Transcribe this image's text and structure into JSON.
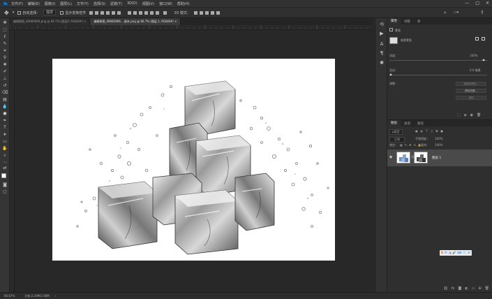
{
  "menubar": {
    "logo": "Ps",
    "items": [
      "文件(F)",
      "编辑(E)",
      "图像(I)",
      "图层(L)",
      "文字(Y)",
      "选择(S)",
      "滤镜(T)",
      "3D(D)",
      "视图(V)",
      "窗口(W)",
      "帮助(H)"
    ],
    "window_controls": [
      "—",
      "□",
      "✕"
    ]
  },
  "options_bar": {
    "auto_select_label": "自动选择：",
    "auto_select_value": "图层",
    "show_transform_label": "显示变换控件",
    "mode_3d_label": "3D 模式："
  },
  "doc_tabs": [
    {
      "label": "编辑原图_49083906.png @ 66.7% (图层0, RGB/8#) ×",
      "active": false
    },
    {
      "label": "编辑原图_49083906... 副本.png @ 66.7% (图层 1, RGB/8#) ×",
      "active": true
    }
  ],
  "status": {
    "zoom": "66.67%",
    "doc_info": "文档:2.20M/2.48M"
  },
  "properties_panel": {
    "tabs": [
      "属性",
      "调整",
      "库"
    ],
    "section_label": "蒙版",
    "mask_label": "像素蒙版",
    "density_label": "浓度：",
    "density_value": "100%",
    "feather_label": "羽化：",
    "feather_value": "0.0 像素",
    "refine_label": "调整：",
    "btn_select_mask": "选择并遮住...",
    "btn_color_range": "颜色范围...",
    "btn_invert": "反相"
  },
  "layers_panel": {
    "tabs": [
      "图层",
      "通道",
      "路径"
    ],
    "filter_kind": "ρ类型",
    "blend_mode": "正常",
    "opacity_label": "不透明度：",
    "opacity_value": "100%",
    "lock_label": "锁定：",
    "fill_label": "填充：",
    "fill_value": "100%",
    "layer_name": "图层 1"
  },
  "icons": {
    "move_tool": "move-icon",
    "layer_visibility": "eye-icon"
  },
  "colors": {
    "accent": "#31a8ff",
    "selected_layer": "#4a4a4a",
    "canvas_bg": "#282828"
  }
}
